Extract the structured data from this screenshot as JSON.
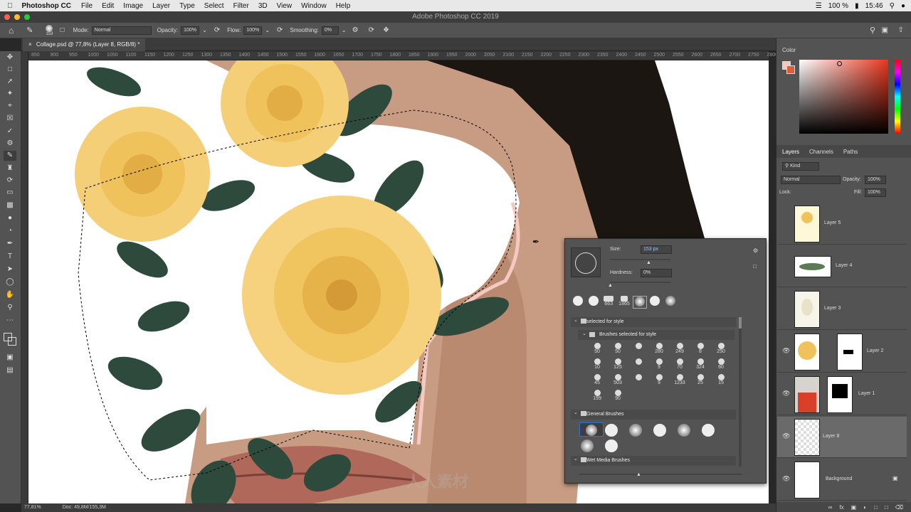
{
  "menubar": {
    "items": [
      "Photoshop CC",
      "File",
      "Edit",
      "Image",
      "Layer",
      "Type",
      "Select",
      "Filter",
      "3D",
      "View",
      "Window",
      "Help"
    ],
    "battery": "100 %",
    "time": "15:46"
  },
  "window_title": "Adobe Photoshop CC 2019",
  "options": {
    "brush_size": "153",
    "mode_label": "Mode:",
    "mode_value": "Normal",
    "opacity_label": "Opacity:",
    "opacity_value": "100%",
    "flow_label": "Flow:",
    "flow_value": "100%",
    "smoothing_label": "Smoothing:",
    "smoothing_value": "0%"
  },
  "document_tab": "Collage.psd @ 77,8% (Layer 8, RGB/8) *",
  "ruler_ticks": [
    "850",
    "900",
    "950",
    "1000",
    "1050",
    "1100",
    "1150",
    "1200",
    "1250",
    "1300",
    "1350",
    "1400",
    "1450",
    "1500",
    "1550",
    "1600",
    "1650",
    "1700",
    "1750",
    "1800",
    "1850",
    "1900",
    "1950",
    "2000",
    "2050",
    "2100",
    "2150",
    "2200",
    "2250",
    "2300",
    "2350",
    "2400",
    "2450",
    "2500",
    "2550",
    "2600",
    "2650",
    "2700",
    "2750",
    "2800"
  ],
  "status": {
    "zoom": "77,81%",
    "doc": "Doc: 49,8M/155,3M"
  },
  "color_panel": {
    "title": "Color"
  },
  "layers_panel": {
    "tabs": [
      "Layers",
      "Channels",
      "Paths"
    ],
    "filter": "Kind",
    "blend": "Normal",
    "opacity_label": "Opacity:",
    "opacity": "100%",
    "lock_label": "Lock:",
    "fill_label": "Fill:",
    "fill": "100%",
    "layers": [
      "Layer 5",
      "Layer 4",
      "Layer 3",
      "Layer 2",
      "Layer 1",
      "Layer 8",
      "Background"
    ]
  },
  "brush_panel": {
    "size_label": "Size:",
    "size_value": "153 px",
    "hardness_label": "Hardness:",
    "hardness_value": "0%",
    "recent": [
      "",
      "",
      "663",
      "1865",
      "",
      "",
      ""
    ],
    "folder1": "selected for style",
    "subfolder": "Brushes selected for style",
    "grid": [
      "50",
      "50",
      "",
      "280",
      "249",
      "8",
      "250",
      "10",
      "125",
      "",
      "9",
      "70",
      "324",
      "60",
      "45",
      "503",
      "",
      "9",
      "1233",
      "25",
      "15",
      "199",
      "90"
    ],
    "folder2": "General Brushes",
    "folder3": "Wet Media Brushes"
  },
  "watermark": "人人素材",
  "colors": {
    "accent": "#2d72d9",
    "swatch_fg": "#f3c7bc",
    "swatch_bg": "#e05a3c"
  }
}
